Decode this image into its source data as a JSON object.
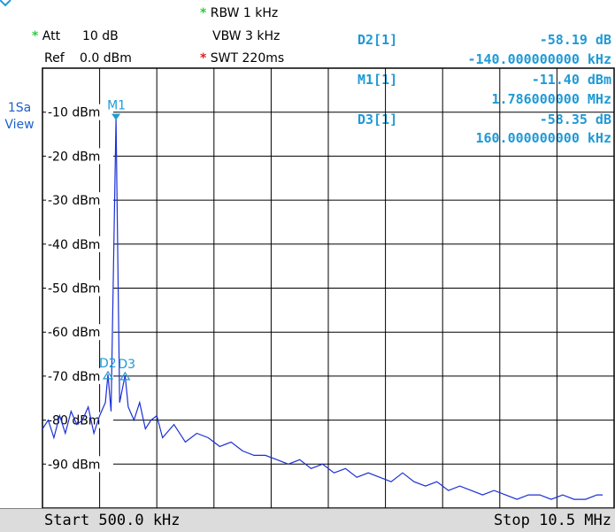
{
  "settings": {
    "rbw": "RBW 1 kHz",
    "vbw": "VBW 3 kHz",
    "swt": "SWT 220ms",
    "att_label": "Att",
    "att_value": "10 dB",
    "ref_label": "Ref",
    "ref_value": "0.0 dBm",
    "star": "*"
  },
  "side_label": {
    "line1": "1Sa",
    "line2": "View"
  },
  "marker_table": [
    {
      "name": "D2[1]",
      "level": "-58.19 dB",
      "freq": "-140.000000000 kHz"
    },
    {
      "name": "M1[1]",
      "level": "-11.40 dBm",
      "freq": "1.786000000 MHz"
    },
    {
      "name": "D3[1]",
      "level": "-58.35 dB",
      "freq": "160.000000000 kHz"
    }
  ],
  "footer": {
    "start": "Start 500.0 kHz",
    "stop": "Stop 10.5 MHz"
  },
  "colors": {
    "trace": "#1a2fd6",
    "marker": "#1f9ad6",
    "grid": "#000000",
    "background": "#ffffff"
  },
  "chart_data": {
    "type": "line",
    "x_unit": "MHz",
    "y_unit": "dBm",
    "xlim": [
      0.5,
      10.5
    ],
    "ylim": [
      -100,
      0
    ],
    "grid": true,
    "y_ticks": [
      "-10 dBm",
      "-20 dBm",
      "-30 dBm",
      "-40 dBm",
      "-50 dBm",
      "-60 dBm",
      "-70 dBm",
      "-80 dBm",
      "-90 dBm"
    ],
    "y_tick_values": [
      -10,
      -20,
      -30,
      -40,
      -50,
      -60,
      -70,
      -80,
      -90
    ],
    "markers": [
      {
        "label": "M1",
        "x": 1.786,
        "y": -11.4
      },
      {
        "label": "D2",
        "x": 1.646,
        "y": -69.6
      },
      {
        "label": "D3",
        "x": 1.946,
        "y": -69.8
      }
    ],
    "series": [
      {
        "x": [
          0.5,
          0.6,
          0.7,
          0.8,
          0.9,
          1.0,
          1.1,
          1.2,
          1.3,
          1.4,
          1.5,
          1.6,
          1.646,
          1.7,
          1.786,
          1.85,
          1.946,
          2.0,
          2.1,
          2.2,
          2.3,
          2.4,
          2.5,
          2.6,
          2.8,
          3.0,
          3.2,
          3.4,
          3.6,
          3.8,
          4.0,
          4.2,
          4.4,
          4.6,
          4.8,
          5.0,
          5.2,
          5.4,
          5.6,
          5.8,
          6.0,
          6.2,
          6.4,
          6.6,
          6.8,
          7.0,
          7.2,
          7.4,
          7.6,
          7.8,
          8.0,
          8.2,
          8.4,
          8.6,
          8.8,
          9.0,
          9.2,
          9.4,
          9.6,
          9.8,
          10.0,
          10.2,
          10.3
        ],
        "y": [
          -82,
          -80,
          -84,
          -79,
          -83,
          -78,
          -81,
          -80,
          -77,
          -83,
          -79,
          -76,
          -69.6,
          -78,
          -11.4,
          -76,
          -69.8,
          -77,
          -80,
          -76,
          -82,
          -80,
          -79,
          -84,
          -81,
          -85,
          -83,
          -84,
          -86,
          -85,
          -87,
          -88,
          -88,
          -89,
          -90,
          -89,
          -91,
          -90,
          -92,
          -91,
          -93,
          -92,
          -93,
          -94,
          -92,
          -94,
          -95,
          -94,
          -96,
          -95,
          -96,
          -97,
          -96,
          -97,
          -98,
          -97,
          -97,
          -98,
          -97,
          -98,
          -98,
          -97,
          -97
        ]
      }
    ]
  }
}
